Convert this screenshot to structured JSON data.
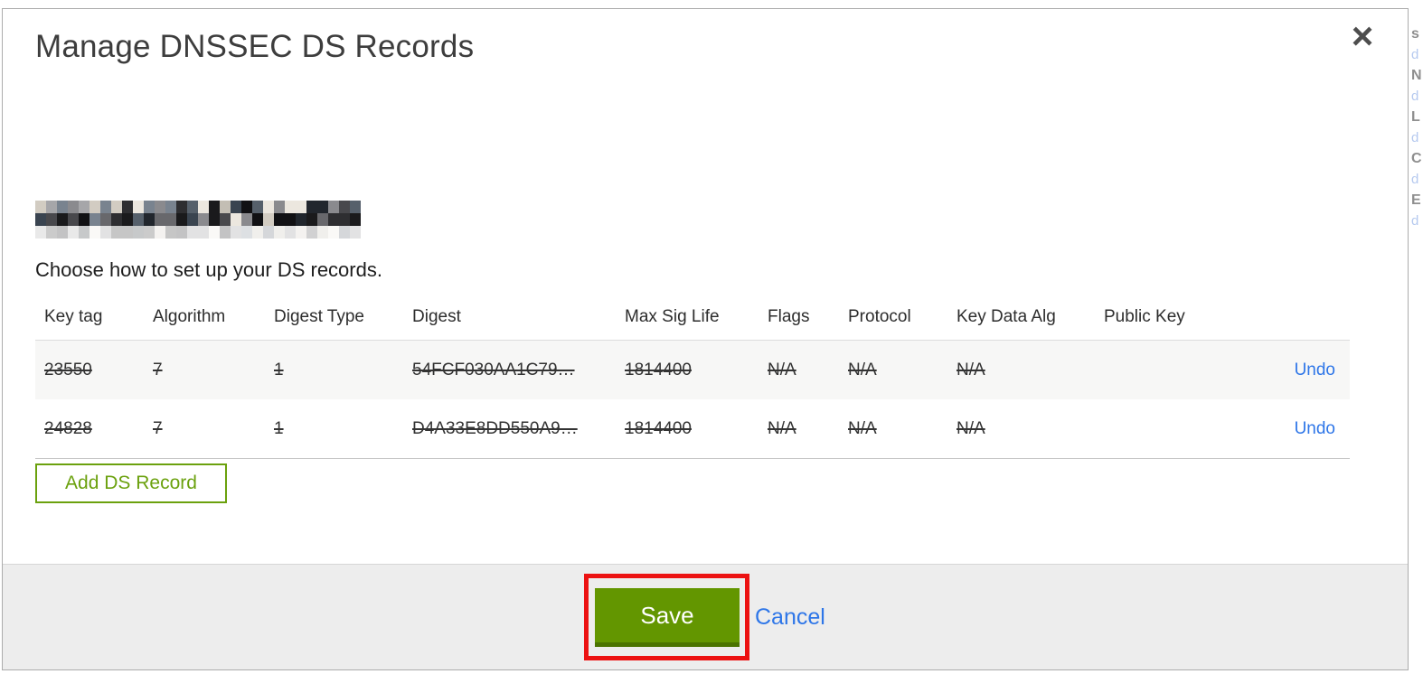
{
  "modal": {
    "title": "Manage DNSSEC DS Records",
    "close_icon": "×",
    "domain": {
      "redacted": true,
      "pixel_palette": [
        "#1a1a1c",
        "#2e2e31",
        "#48484c",
        "#68686c",
        "#8a8a8e",
        "#a6a6a9",
        "#3a4450",
        "#21262d",
        "#ece7df",
        "#d2ccc2",
        "#56606b",
        "#79838f",
        "#111114",
        "#c3beb4"
      ]
    },
    "instruction": "Choose how to set up your DS records.",
    "table": {
      "columns": [
        "Key tag",
        "Algorithm",
        "Digest Type",
        "Digest",
        "Max Sig Life",
        "Flags",
        "Protocol",
        "Key Data Alg",
        "Public Key",
        ""
      ],
      "rows": [
        {
          "key_tag": "23550",
          "algorithm": "7",
          "digest_type": "1",
          "digest": "54FCF030AA1C79…",
          "max_sig_life": "1814400",
          "flags": "N/A",
          "protocol": "N/A",
          "key_data_alg": "N/A",
          "public_key": "",
          "action": "Undo",
          "struck": true
        },
        {
          "key_tag": "24828",
          "algorithm": "7",
          "digest_type": "1",
          "digest": "D4A33E8DD550A9…",
          "max_sig_life": "1814400",
          "flags": "N/A",
          "protocol": "N/A",
          "key_data_alg": "N/A",
          "public_key": "",
          "action": "Undo",
          "struck": true
        }
      ]
    },
    "add_button_label": "Add DS Record",
    "footer": {
      "save_label": "Save",
      "cancel_label": "Cancel"
    }
  },
  "annotation": {
    "type": "highlight-box",
    "target": "save-button",
    "color": "#ec1212"
  },
  "background_sliver": {
    "fragments": [
      "s",
      "d",
      "N",
      "d",
      "L",
      "d",
      "C",
      "d",
      "E",
      "d"
    ]
  },
  "colors": {
    "accent_green": "#639600",
    "accent_green_dark": "#4a7300",
    "outline_green": "#6ba10e",
    "link_blue": "#2e76e8",
    "footer_gray": "#ededed",
    "row_stripe": "#f7f7f6",
    "modal_border": "#acacac",
    "title_text": "#3d3d3d",
    "body_text": "#333333"
  }
}
